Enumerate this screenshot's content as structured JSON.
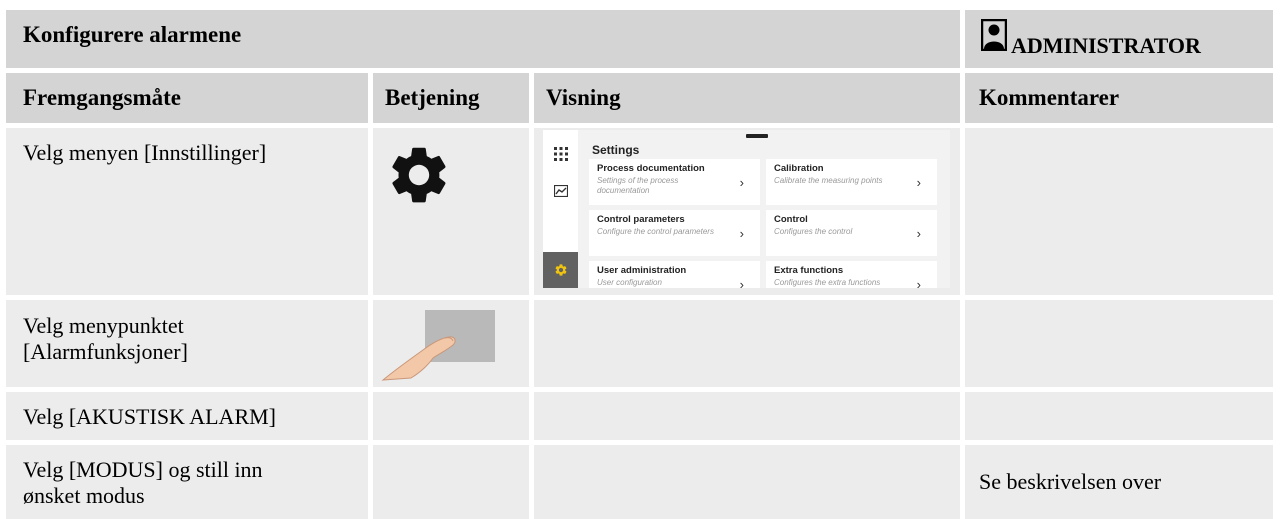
{
  "header": {
    "title": "Konfigurere alarmene",
    "role": "ADMINISTRATOR"
  },
  "columns": {
    "procedure": "Fremgangsmåte",
    "operation": "Betjening",
    "display": "Visning",
    "comments": "Kommentarer"
  },
  "rows": [
    {
      "procedure": "Velg menyen [Innstillinger]",
      "comment": ""
    },
    {
      "procedure": "Velg menypunktet [Alarmfunksjoner]",
      "comment": ""
    },
    {
      "procedure": "Velg [AKUSTISK ALARM]",
      "comment": ""
    },
    {
      "procedure": "Velg [MODUS] og still inn ønsket modus",
      "comment": "Se beskrivelsen over"
    }
  ],
  "settings_screen": {
    "title": "Settings",
    "tiles": [
      {
        "title": "Process documentation",
        "subtitle": "Settings of the process documentation"
      },
      {
        "title": "Calibration",
        "subtitle": "Calibrate the measuring points"
      },
      {
        "title": "Control parameters",
        "subtitle": "Configure the control parameters"
      },
      {
        "title": "Control",
        "subtitle": "Configures the control"
      },
      {
        "title": "User administration",
        "subtitle": "User configuration"
      },
      {
        "title": "Extra functions",
        "subtitle": "Configures the extra functions"
      }
    ],
    "chevron": "›",
    "icons": [
      "apps-grid-icon",
      "chart-icon",
      "gear-icon"
    ]
  },
  "icons": {
    "role_icon": "person-icon",
    "operation_icons": [
      "gear-icon",
      "finger-tap-icon"
    ]
  }
}
